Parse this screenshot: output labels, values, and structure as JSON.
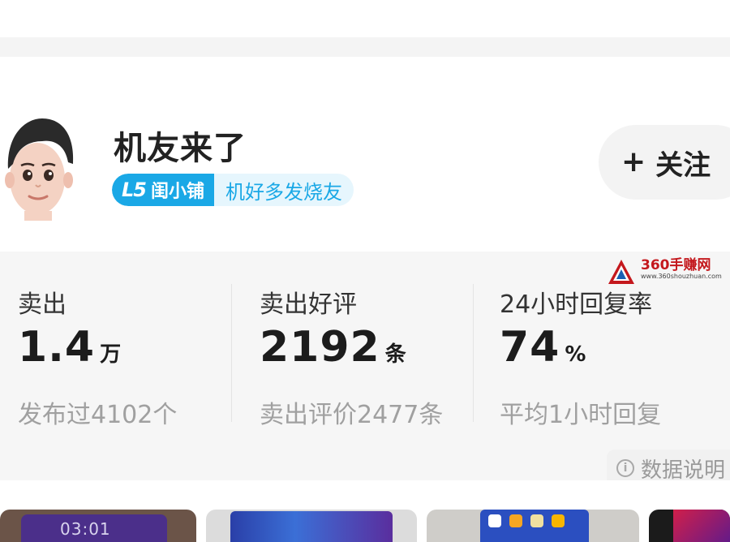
{
  "profile": {
    "username": "机友来了",
    "badge": {
      "level": "L5",
      "shop": "闺小铺",
      "tag": "机好多发烧友"
    },
    "follow_button": {
      "icon": "plus-icon",
      "label": "关注"
    }
  },
  "stats": [
    {
      "label": "卖出",
      "value": "1.4",
      "unit": "万",
      "sub": "发布过4102个"
    },
    {
      "label": "卖出好评",
      "value": "2192",
      "unit": "条",
      "sub": "卖出评价2477条"
    },
    {
      "label": "24小时回复率",
      "value": "74",
      "unit": "%",
      "sub": "平均1小时回复"
    }
  ],
  "data_note": {
    "icon": "info-icon",
    "label": "数据说明"
  },
  "watermark": {
    "title": "360手赚网",
    "url": "www.360shouzhuan.com"
  },
  "thumbnails": [
    {
      "name": "listing-thumb-1",
      "time": "03:01"
    },
    {
      "name": "listing-thumb-2"
    },
    {
      "name": "listing-thumb-3"
    },
    {
      "name": "listing-thumb-4"
    }
  ],
  "colors": {
    "accent": "#1aa8e6",
    "badge_bg": "#e6f6fd",
    "stats_bg": "#f6f6f6",
    "muted_text": "#a0a0a0",
    "watermark_red": "#c4181d"
  }
}
